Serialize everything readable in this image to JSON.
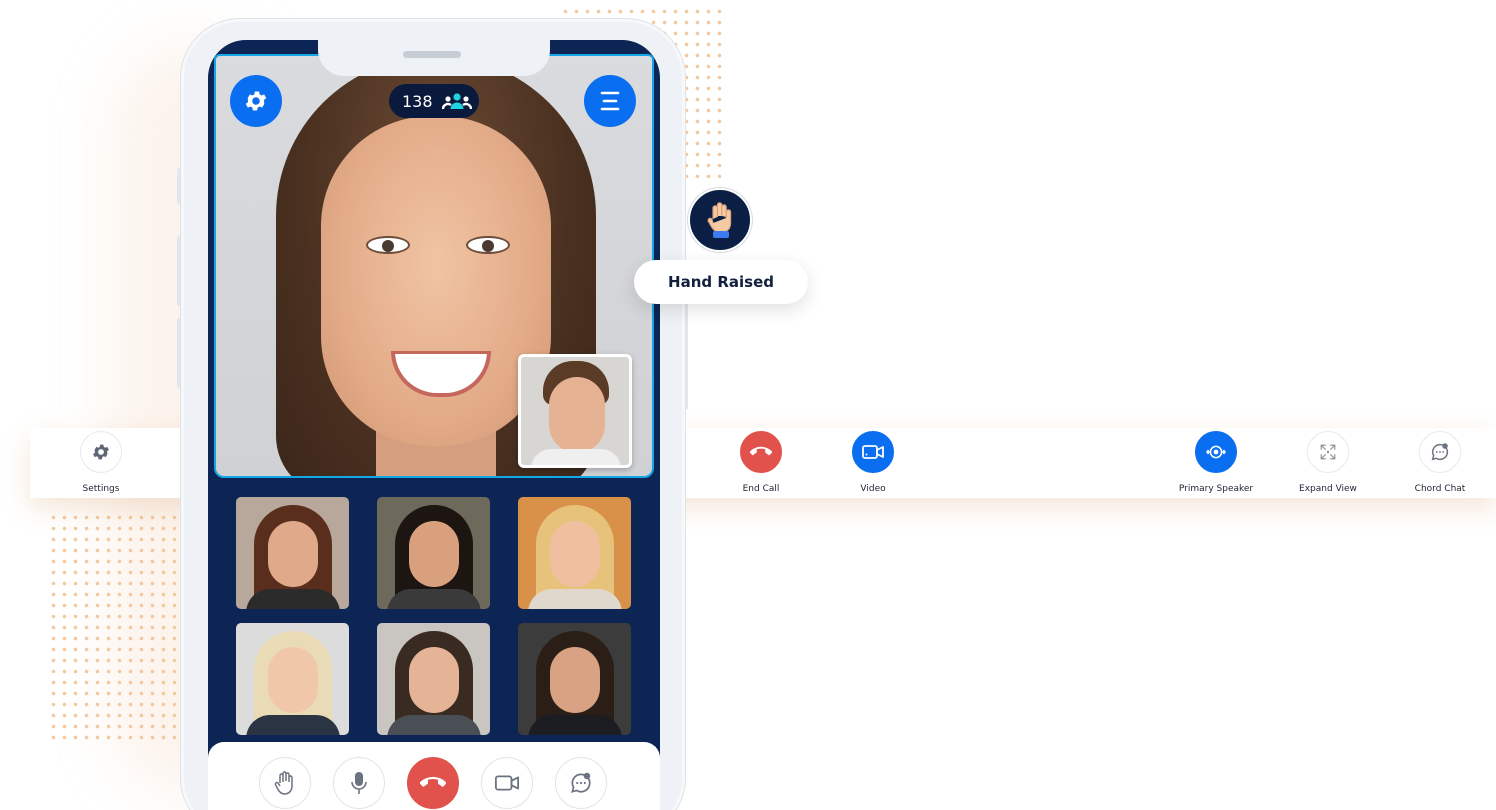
{
  "toolbar": {
    "settings_label": "Settings",
    "end_call_label": "End Call",
    "video_label": "Video",
    "primary_speaker_label": "Primary Speaker",
    "expand_view_label": "Expand View",
    "chord_chat_label": "Chord Chat"
  },
  "phone": {
    "participant_count": "138",
    "icons": {
      "settings": "gear-icon",
      "menu": "hamburger-menu-icon",
      "participants": "people-icon"
    },
    "bottom_controls": [
      "raise-hand",
      "microphone",
      "end-call",
      "video",
      "chat"
    ]
  },
  "hand_raised": {
    "label": "Hand Raised",
    "icon": "raised-hand-icon"
  },
  "colors": {
    "accent_blue": "#0a6ef1",
    "end_call_red": "#e2524c",
    "screen_navy": "#0c2554",
    "dots_peach": "#f3c9a0"
  }
}
